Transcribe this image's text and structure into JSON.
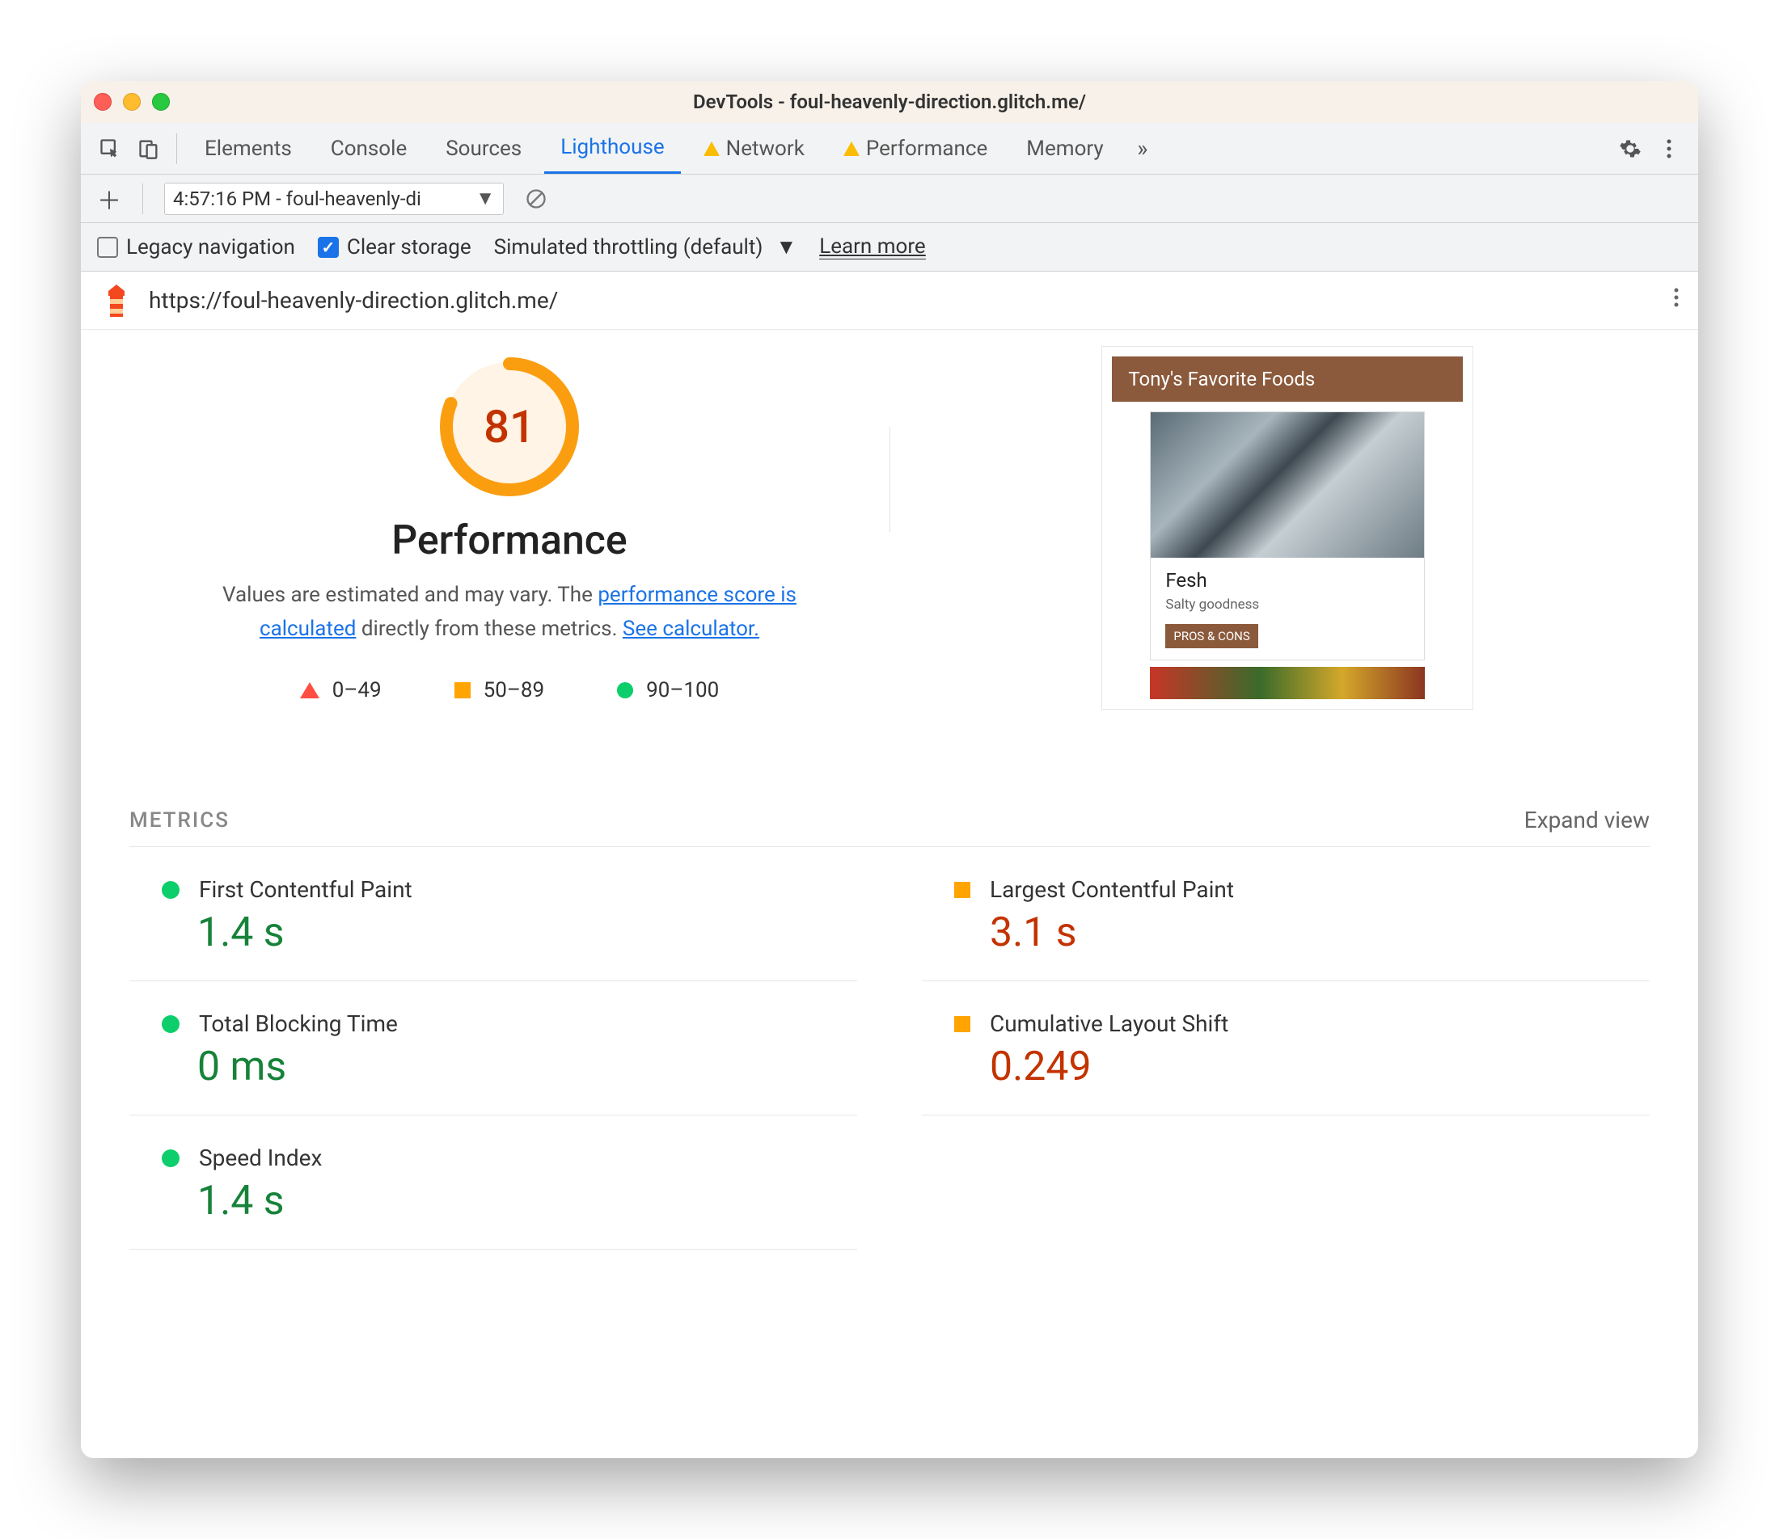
{
  "window": {
    "title": "DevTools - foul-heavenly-direction.glitch.me/"
  },
  "tabs": {
    "elements": "Elements",
    "console": "Console",
    "sources": "Sources",
    "lighthouse": "Lighthouse",
    "network": "Network",
    "performance": "Performance",
    "memory": "Memory"
  },
  "run_selector": "4:57:16 PM - foul-heavenly-di",
  "options": {
    "legacy_label": "Legacy navigation",
    "clear_label": "Clear storage",
    "throttling_label": "Simulated throttling (default)",
    "learn_more": "Learn more"
  },
  "url": "https://foul-heavenly-direction.glitch.me/",
  "gauge": {
    "score": "81",
    "title": "Performance"
  },
  "desc": {
    "t1": "Values are estimated and may vary. The ",
    "l1": "performance score is calculated",
    "t2": " directly from these metrics. ",
    "l2": "See calculator."
  },
  "legend": {
    "r1": "0–49",
    "r2": "50–89",
    "r3": "90–100"
  },
  "preview": {
    "header": "Tony's Favorite Foods",
    "product": "Fesh",
    "sub": "Salty goodness",
    "btn": "PROS & CONS"
  },
  "metrics": {
    "title": "METRICS",
    "expand": "Expand view",
    "items": [
      {
        "label": "First Contentful Paint",
        "value": "1.4 s",
        "status": "good"
      },
      {
        "label": "Largest Contentful Paint",
        "value": "3.1 s",
        "status": "avg"
      },
      {
        "label": "Total Blocking Time",
        "value": "0 ms",
        "status": "good"
      },
      {
        "label": "Cumulative Layout Shift",
        "value": "0.249",
        "status": "avg"
      },
      {
        "label": "Speed Index",
        "value": "1.4 s",
        "status": "good"
      }
    ]
  }
}
